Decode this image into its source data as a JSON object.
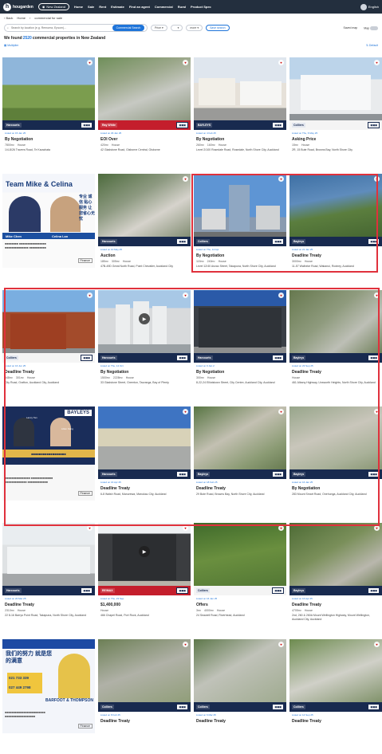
{
  "topnav": {
    "brand": "hougarden",
    "region": "New Zealand",
    "items": [
      "Home",
      "Sale",
      "Rent",
      "Estimate",
      "Find an agent",
      "Commercial",
      "Rural",
      "Product Spec"
    ],
    "user": "English"
  },
  "breadcrumb": {
    "back": "Back",
    "home": "Home",
    "current": "commercial for sale"
  },
  "search": {
    "placeholder": "Search by location (e.g. Remuera, Epsom)...",
    "button": "Commercial Search",
    "price": "Price",
    "more": "more",
    "save": "Save search",
    "saved_map": "Saved map",
    "map": "Map"
  },
  "results": {
    "prefix": "We found",
    "count": "2520",
    "suffix": "commercial properties in New Zealand"
  },
  "subtools": {
    "left": "Multiplier",
    "right": "Default"
  },
  "colors": {
    "nav": "#232f3e",
    "accent": "#1e74d9",
    "highlight": "#e0313c"
  },
  "cards": [
    {
      "listed": "Listed on 15 Jan 25",
      "price": "By Negotiation",
      "specs": [
        "7800m²",
        "House"
      ],
      "addr": "1/4-8/26 Travers Road, Te Kauwhata",
      "band": "navy",
      "logo": "Harcourts",
      "bg": "field"
    },
    {
      "listed": "Listed on 29 Jan 25",
      "price": "EOI Over",
      "specs": [
        "420m²",
        "House"
      ],
      "addr": "42 Gladstone Road, Gisborne Central, Gisborne",
      "band": "red",
      "logo": "Ray White",
      "bg": "aerial"
    },
    {
      "listed": "Listed on 4 Feb 25",
      "price": "By Negotiation",
      "specs": [
        "260m²",
        "160m²",
        "House"
      ],
      "addr": "Level 2/100 Rosedale Road, Rosedale, North Shore City, Auckland",
      "band": "navy",
      "logo": "BAYLEYS",
      "bg": "street"
    },
    {
      "listed": "Listed on Thu, 6 May 25",
      "price": "Asking Price",
      "specs": [
        "15m²",
        "House"
      ],
      "addr": "2R, 15 Bute Road, Browns Bay, North Shore City",
      "band": "white",
      "logo": "Colliers",
      "bg": "modern"
    },
    {
      "listed": "",
      "price": "",
      "specs": [],
      "addr": "",
      "band": "",
      "logo": "",
      "bg": "promo1"
    },
    {
      "listed": "Listed on 10 May 25",
      "price": "Auction",
      "specs": [
        "185m²",
        "305m²",
        "House"
      ],
      "addr": "47B-49D Great North Road, Point Chevalier, Auckland City",
      "band": "navy",
      "logo": "Harcourts",
      "bg": "aerial2"
    },
    {
      "listed": "Listed on Thu, 14 Apr",
      "price": "By Negotiation",
      "specs": [
        "115m²",
        "240m²",
        "House"
      ],
      "addr": "Level 12/40 Anzac Street, Takapuna, North Shore City, Auckland",
      "band": "navy",
      "logo": "Colliers",
      "bg": "tower"
    },
    {
      "listed": "Listed on 21 Jan 25",
      "price": "Deadline Treaty",
      "specs": [
        "3000m²",
        "House"
      ],
      "addr": "11-57 Waiheke Road, Wakanui, Rodney, Auckland",
      "band": "navy",
      "logo": "Bayleys",
      "bg": "coast"
    },
    {
      "listed": "Listed on 16 Jun 25",
      "price": "Deadline Treaty",
      "specs": [
        "548m²",
        "301m²",
        "House"
      ],
      "addr": "City Road, Grafton, Auckland City, Auckland",
      "band": "white",
      "logo": "Colliers",
      "bg": "brick"
    },
    {
      "listed": "Listed on Thu, 14 Oct",
      "price": "By Negotiation",
      "specs": [
        "1500m²",
        "2228m²",
        "House"
      ],
      "addr": "33 Gladstone Street, Greerton, Tauranga, Bay of Plenty",
      "band": "navy",
      "logo": "Harcourts",
      "bg": "tanks"
    },
    {
      "listed": "Listed on 9 Jan 2",
      "price": "By Negotiation",
      "specs": [
        "300m²",
        "House"
      ],
      "addr": "8-22-24 Elliotstown Street, City Centre, Auckland City, Auckland",
      "band": "navy",
      "logo": "Harcourts",
      "bg": "heritage"
    },
    {
      "listed": "Listed on 23 Sep 25",
      "price": "Deadline Treaty",
      "specs": [
        "House"
      ],
      "addr": "461 Albany Highway, Unsworth Heights, North Shore City, Auckland",
      "band": "navy",
      "logo": "Bayleys",
      "bg": "aerial3"
    },
    {
      "listed": "",
      "price": "",
      "specs": [],
      "addr": "",
      "band": "",
      "logo": "",
      "bg": "promo2"
    },
    {
      "listed": "Listed on 16 Apr 25",
      "price": "Deadline Treaty",
      "specs": [],
      "addr": "6-8 Walsh Road, Manurewa, Manukau City, Auckland",
      "band": "navy",
      "logo": "Harcourts",
      "bg": "lot"
    },
    {
      "listed": "Listed on 18 Feb 25",
      "price": "Deadline Treaty",
      "specs": [],
      "addr": "29 Bute Road, Browns Bay, North Shore City, Auckland",
      "band": "navy",
      "logo": "Bayleys",
      "bg": "suburb"
    },
    {
      "listed": "Listed on 16 Jan 25",
      "price": "By Negotiation",
      "specs": [],
      "addr": "283 Mount Smart Road, Onehunga, Auckland City, Auckland",
      "band": "navy",
      "logo": "Bayleys",
      "bg": "map"
    },
    {
      "listed": "Listed on 20 Mar 25",
      "price": "Deadline Treaty",
      "specs": [
        "2310m²",
        "House"
      ],
      "addr": "22 8-16 Barrys Point Road, Takapuna, North Shore City, Auckland",
      "band": "navy",
      "logo": "Harcourts",
      "bg": "warehouse"
    },
    {
      "listed": "Listed on Thu, 23 Sep",
      "price": "$1,400,000",
      "specs": [
        "House"
      ],
      "addr": "466 Chapel Road, Port Rock, Auckland",
      "band": "red",
      "logo": "RE/MAX",
      "bg": "townhouse"
    },
    {
      "listed": "Listed on 16 Jan 25",
      "price": "Offers",
      "specs": [
        "3m²",
        "4000m²",
        "House"
      ],
      "addr": "24 Seawell Road, Riverhead, Auckland",
      "band": "white",
      "logo": "Colliers",
      "bg": "field2"
    },
    {
      "listed": "Listed on 16 Apr 25",
      "price": "Deadline Treaty",
      "specs": [
        "4705m²",
        "House"
      ],
      "addr": "2nd, 260 & 260A Mount Wellington Highway, Mount Wellington, Auckland City, Auckland",
      "band": "navy",
      "logo": "Bayleys",
      "bg": "trees"
    },
    {
      "listed": "",
      "price": "",
      "specs": [],
      "addr": "",
      "band": "",
      "logo": "",
      "bg": "promo3"
    },
    {
      "listed": "Listed on 8 Feb 25",
      "price": "Deadline Treaty",
      "specs": [],
      "addr": "",
      "band": "navy",
      "logo": "Colliers",
      "bg": "aerial4"
    },
    {
      "listed": "Listed on 6 Mar 25",
      "price": "Deadline Treaty",
      "specs": [],
      "addr": "",
      "band": "navy",
      "logo": "Colliers",
      "bg": "lot2"
    },
    {
      "listed": "Listed on 14 Sep 25",
      "price": "Deadline Treaty",
      "specs": [],
      "addr": "",
      "band": "navy",
      "logo": "Colliers",
      "bg": "highway"
    }
  ],
  "promos": {
    "p1": {
      "title": "Team Mike & Celina",
      "agent1": "Mike Chen",
      "agent2": "Celina Lan",
      "blurb": "专业 诚信 贴心服务 让您省心无忧",
      "button": "Finance"
    },
    "p2": {
      "title": "BAYLEYS",
      "agent1": "Lancy Tan",
      "agent2": "Lilian Kang",
      "phone1": "021 539 193",
      "phone2": "021 276 6668",
      "button": "Finance"
    },
    "p3": {
      "title": "我们的努力 就是您的满意",
      "phone1": "021 733 339",
      "phone2": "027 449 2798",
      "brand": "BARFOOT & THOMPSON",
      "button": "Finance"
    }
  }
}
